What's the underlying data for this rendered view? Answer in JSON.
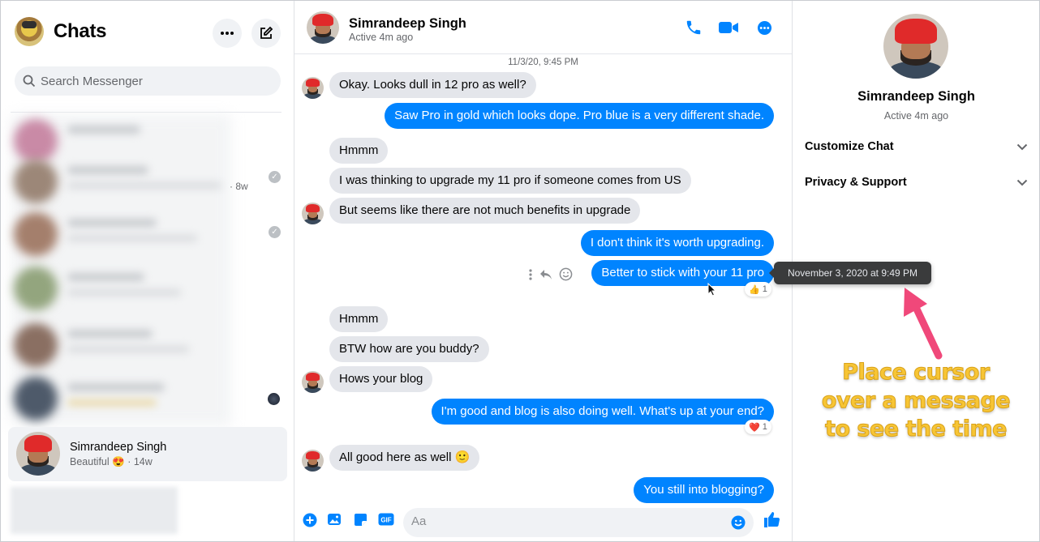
{
  "sidebar": {
    "title": "Chats",
    "search_placeholder": "Search Messenger",
    "blurred_meta": "8w",
    "active_chat": {
      "name": "Simrandeep Singh",
      "preview": "Beautiful",
      "preview_emoji": "😍",
      "time": "· 14w"
    }
  },
  "header": {
    "name": "Simrandeep Singh",
    "status": "Active 4m ago"
  },
  "messages": {
    "timestamp": "11/3/20, 9:45 PM",
    "items": [
      {
        "side": "in",
        "text": "Okay. Looks dull in 12 pro as well?"
      },
      {
        "side": "out",
        "text": "Saw Pro in gold which looks dope. Pro blue is a very different shade."
      },
      {
        "side": "in",
        "text": "Hmmm"
      },
      {
        "side": "in",
        "text": "I was thinking to upgrade my 11 pro if someone comes from US"
      },
      {
        "side": "in",
        "text": "But seems like there are not much benefits in upgrade"
      },
      {
        "side": "out",
        "text": "I don't think it's worth upgrading."
      },
      {
        "side": "out",
        "text": "Better to stick with your 11 pro",
        "reaction": "👍",
        "reaction_count": "1"
      },
      {
        "side": "in",
        "text": "Hmmm"
      },
      {
        "side": "in",
        "text": "BTW how are you buddy?"
      },
      {
        "side": "in",
        "text": "Hows your blog"
      },
      {
        "side": "out",
        "text": "I'm good and blog is also doing well. What's up at your end?",
        "reaction": "❤️",
        "reaction_count": "1"
      },
      {
        "side": "in",
        "text": "All good here as well 🙂"
      },
      {
        "side": "out",
        "text": "You still into blogging?"
      }
    ]
  },
  "composer": {
    "placeholder": "Aa"
  },
  "details": {
    "name": "Simrandeep Singh",
    "status": "Active 4m ago",
    "customize": "Customize Chat",
    "privacy": "Privacy & Support"
  },
  "tooltip": "November 3, 2020 at 9:49 PM",
  "annotation": {
    "line1": "Place cursor",
    "line2": "over a message",
    "line3": "to see the time"
  },
  "colors": {
    "accent": "#0084ff",
    "incoming": "#e4e6eb",
    "annotation": "#f7c535",
    "arrow": "#f0487a"
  }
}
